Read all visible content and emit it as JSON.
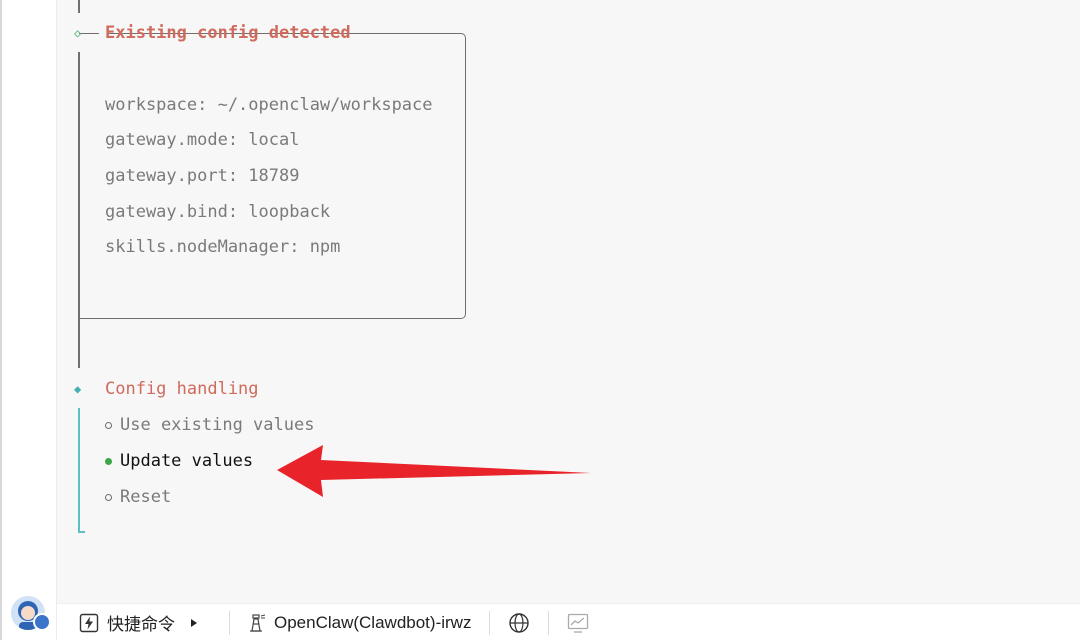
{
  "config_box": {
    "title": "Existing config detected",
    "lines": [
      "workspace: ~/.openclaw/workspace",
      "gateway.mode: local",
      "gateway.port: 18789",
      "gateway.bind: loopback",
      "skills.nodeManager: npm"
    ]
  },
  "prompt": {
    "title": "Config handling",
    "options": [
      {
        "label": "Use existing values",
        "selected": false
      },
      {
        "label": "Update values",
        "selected": true
      },
      {
        "label": "Reset",
        "selected": false
      }
    ]
  },
  "markers": {
    "done": "◇",
    "active": "◆"
  },
  "taskbar": {
    "quick_commands": "快捷命令",
    "session": "OpenClaw(Clawdbot)-irwz"
  },
  "colors": {
    "title_red": "#cf6a5d",
    "teal": "#47aeb6",
    "selected_green": "#3aa74a",
    "annotation_arrow": "#e8232a"
  }
}
